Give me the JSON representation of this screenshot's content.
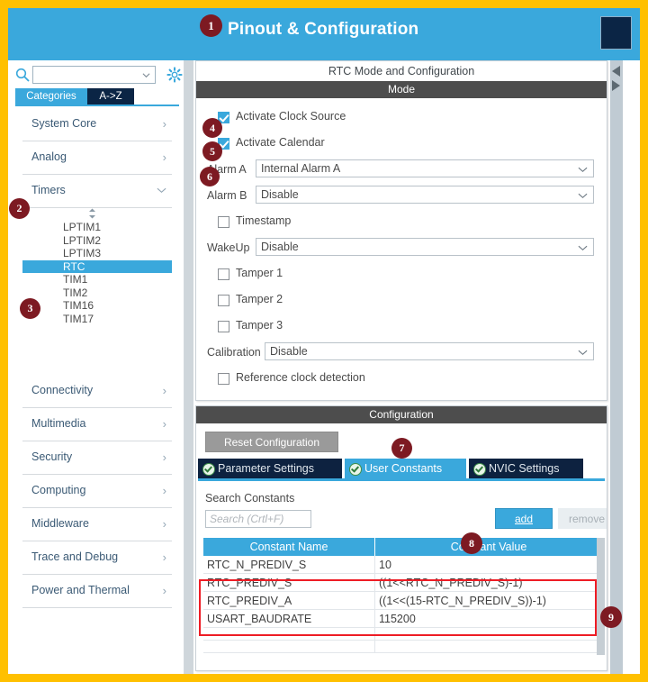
{
  "banner": {
    "title": "Pinout & Configuration"
  },
  "sidebar": {
    "search_placeholder": "",
    "search_value": "",
    "tabs": [
      {
        "label": "Categories",
        "active": true
      },
      {
        "label": "A->Z",
        "active": false
      }
    ],
    "categories": [
      {
        "label": "System Core",
        "expanded": false,
        "chevron": "›"
      },
      {
        "label": "Analog",
        "expanded": false,
        "chevron": "›"
      },
      {
        "label": "Timers",
        "expanded": true,
        "chevron": "∨"
      },
      {
        "label": "Connectivity",
        "expanded": false,
        "chevron": "›"
      },
      {
        "label": "Multimedia",
        "expanded": false,
        "chevron": "›"
      },
      {
        "label": "Security",
        "expanded": false,
        "chevron": "›"
      },
      {
        "label": "Computing",
        "expanded": false,
        "chevron": "›"
      },
      {
        "label": "Middleware",
        "expanded": false,
        "chevron": "›"
      },
      {
        "label": "Trace and Debug",
        "expanded": false,
        "chevron": "›"
      },
      {
        "label": "Power and Thermal",
        "expanded": false,
        "chevron": "›"
      }
    ],
    "timers_peripherals": [
      {
        "label": "LPTIM1",
        "selected": false
      },
      {
        "label": "LPTIM2",
        "selected": false
      },
      {
        "label": "LPTIM3",
        "selected": false
      },
      {
        "label": "RTC",
        "selected": true
      },
      {
        "label": "TIM1",
        "selected": false
      },
      {
        "label": "TIM2",
        "selected": false
      },
      {
        "label": "TIM16",
        "selected": false
      },
      {
        "label": "TIM17",
        "selected": false
      }
    ]
  },
  "mode_card": {
    "title": "RTC Mode and Configuration",
    "section": "Mode",
    "checkboxes_top": [
      {
        "label": "Activate Clock Source",
        "checked": true
      },
      {
        "label": "Activate Calendar",
        "checked": true
      }
    ],
    "alarm_a": {
      "label": "Alarm A",
      "value": "Internal Alarm A"
    },
    "alarm_b": {
      "label": "Alarm B",
      "value": "Disable"
    },
    "timestamp": {
      "label": "Timestamp",
      "checked": false
    },
    "wakeup": {
      "label": "WakeUp",
      "value": "Disable"
    },
    "tampers": [
      {
        "label": "Tamper 1",
        "checked": false
      },
      {
        "label": "Tamper 2",
        "checked": false
      },
      {
        "label": "Tamper 3",
        "checked": false
      }
    ],
    "calibration": {
      "label": "Calibration",
      "value": "Disable"
    },
    "ref_clock": {
      "label": "Reference clock detection",
      "checked": false
    }
  },
  "config_card": {
    "section": "Configuration",
    "reset_button": "Reset Configuration",
    "tabs": [
      {
        "label": "Parameter Settings",
        "active": false
      },
      {
        "label": "User Constants",
        "active": true
      },
      {
        "label": "NVIC Settings",
        "active": false
      }
    ],
    "search_label": "Search Constants",
    "search_placeholder": "Search (Crtl+F)",
    "add_button": "add",
    "remove_button": "remove",
    "table": {
      "headers": [
        "Constant Name",
        "Constant Value"
      ],
      "rows": [
        [
          "RTC_N_PREDIV_S",
          "10"
        ],
        [
          "RTC_PREDIV_S",
          "((1<<RTC_N_PREDIV_S)-1)"
        ],
        [
          "RTC_PREDIV_A",
          "((1<<(15-RTC_N_PREDIV_S))-1)"
        ],
        [
          "USART_BAUDRATE",
          "115200"
        ]
      ]
    }
  },
  "badges": {
    "b1": "1",
    "b2": "2",
    "b3": "3",
    "b4": "4",
    "b5": "5",
    "b6": "6",
    "b7": "7",
    "b8": "8",
    "b9": "9"
  },
  "colors": {
    "accent_blue": "#3aa8dc",
    "dark_navy": "#0d2240",
    "badge_red": "#7d1a22",
    "frame_yellow": "#ffc000",
    "highlight_red": "#ee1c25",
    "section_gray": "#4d4d4d"
  }
}
